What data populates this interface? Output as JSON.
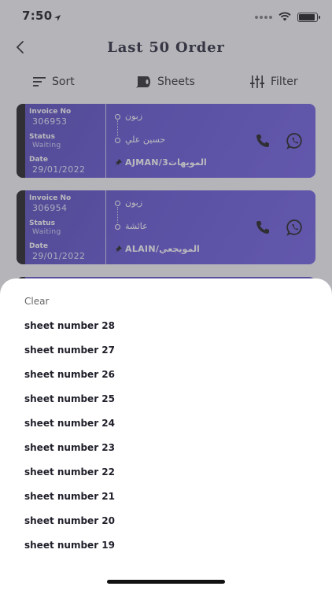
{
  "status_bar": {
    "time": "7:50"
  },
  "header": {
    "title": "Last 50 Order"
  },
  "toolbar": {
    "sort_label": "Sort",
    "sheets_label": "Sheets",
    "filter_label": "Filter"
  },
  "orders": [
    {
      "invoice_label": "Invoice No",
      "invoice_no": "306953",
      "status_label": "Status",
      "status": "Waiting",
      "date_label": "Date",
      "date": "29/01/2022",
      "from": "زبون",
      "to": "حسين علي",
      "location": "AJMAN/3المويهات"
    },
    {
      "invoice_label": "Invoice No",
      "invoice_no": "306954",
      "status_label": "Status",
      "status": "Waiting",
      "date_label": "Date",
      "date": "29/01/2022",
      "from": "زبون",
      "to": "عائشة",
      "location": "ALAIN/المويجعي"
    }
  ],
  "sheet_menu": {
    "clear_label": "Clear",
    "items": [
      "sheet number 28",
      "sheet number 27",
      "sheet number 26",
      "sheet number 25",
      "sheet number 24",
      "sheet number 23",
      "sheet number 22",
      "sheet number 21",
      "sheet number 20",
      "sheet number 19"
    ]
  }
}
